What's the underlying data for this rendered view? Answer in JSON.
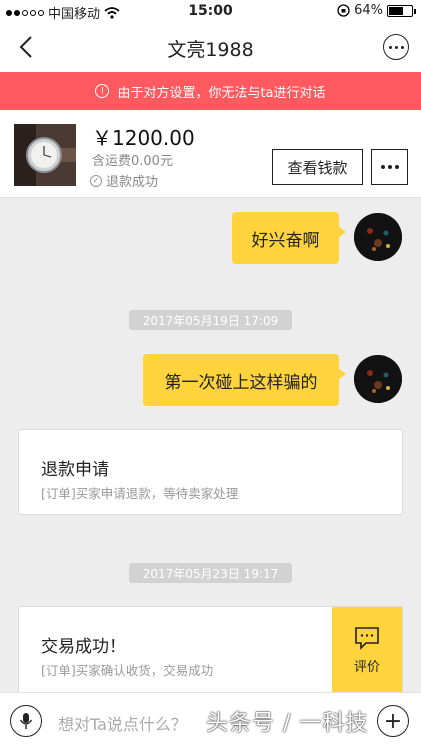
{
  "status_bar": {
    "carrier": "中国移动",
    "time": "15:00",
    "battery": "64%"
  },
  "nav": {
    "title": "文亮1988"
  },
  "notice": {
    "text": "由于对方设置，你无法与ta进行对话"
  },
  "product": {
    "price": "￥1200.00",
    "shipping": "含运费0.00元",
    "status": "退款成功",
    "view_button": "查看钱款"
  },
  "messages": [
    {
      "text": "好兴奋啊"
    },
    {
      "text": "第一次碰上这样骗的"
    }
  ],
  "timestamps": [
    "2017年05月19日 17:09",
    "2017年05月23日 19:17"
  ],
  "cards": [
    {
      "title": "退款申请",
      "subtitle": "[订单]买家申请退款，等待卖家处理"
    },
    {
      "title": "交易成功！",
      "subtitle": "[订单]买家确认收货，交易成功",
      "action": "评价"
    }
  ],
  "input": {
    "placeholder": "想对Ta说点什么？"
  },
  "watermark": "头条号 / 一科技",
  "colors": {
    "notice_bg": "#ff5a5f",
    "bubble": "#ffd33c",
    "background": "#ededed"
  }
}
